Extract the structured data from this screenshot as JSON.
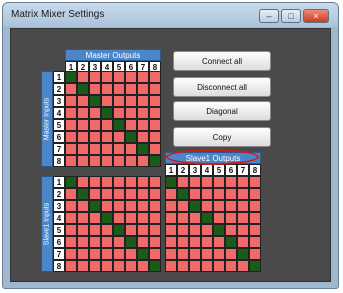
{
  "window": {
    "title": "Matrix Mixer Settings",
    "minimize": "–",
    "maximize": "□",
    "close": "×"
  },
  "master_outputs": {
    "label": "Master Outputs",
    "numbers": [
      "1",
      "2",
      "3",
      "4",
      "5",
      "6",
      "7",
      "8"
    ]
  },
  "master_inputs": {
    "label": "Master Inputs",
    "numbers": [
      "1",
      "2",
      "3",
      "4",
      "5",
      "6",
      "7",
      "8"
    ]
  },
  "slave_inputs": {
    "label": "Slave1 Inputs",
    "numbers": [
      "1",
      "2",
      "3",
      "4",
      "5",
      "6",
      "7",
      "8"
    ]
  },
  "slave_outputs": {
    "label": "Slave1 Outputs",
    "numbers": [
      "1",
      "2",
      "3",
      "4",
      "5",
      "6",
      "7",
      "8"
    ]
  },
  "buttons": {
    "connect_all": "Connect all",
    "disconnect_all": "Disconnect all",
    "diagonal": "Diagonal",
    "copy": "Copy"
  },
  "colors": {
    "connected": "#1c5a1c",
    "disconnected": "#f06a6a",
    "header": "#4a86c8",
    "highlight": "#d11a1a"
  },
  "matrix_state": "diagonal"
}
